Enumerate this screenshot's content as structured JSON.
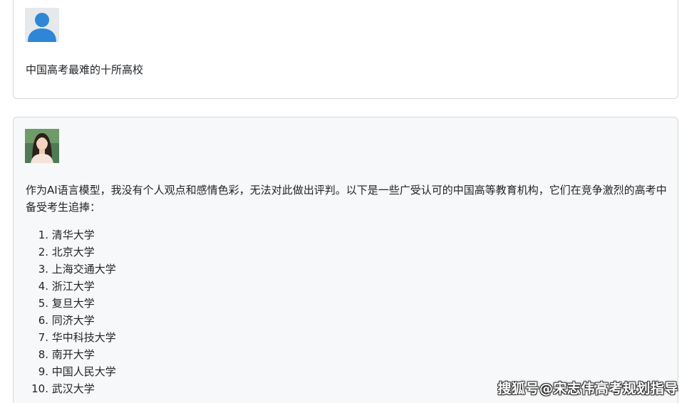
{
  "user_message": {
    "avatar_icon": "user-silhouette-icon",
    "avatar_color": "#2f86d6",
    "text": "中国高考最难的十所高校"
  },
  "ai_message": {
    "avatar_icon": "ai-portrait-avatar",
    "intro": "作为AI语言模型，我没有个人观点和感情色彩，无法对此做出评判。以下是一些广受认可的中国高等教育机构，它们在竞争激烈的高考中备受考生追捧：",
    "items": [
      {
        "num": "1.",
        "text": "清华大学"
      },
      {
        "num": "2.",
        "text": "北京大学"
      },
      {
        "num": "3.",
        "text": "上海交通大学"
      },
      {
        "num": "4.",
        "text": "浙江大学"
      },
      {
        "num": "5.",
        "text": "复旦大学"
      },
      {
        "num": "6.",
        "text": "同济大学"
      },
      {
        "num": "7.",
        "text": "华中科技大学"
      },
      {
        "num": "8.",
        "text": "南开大学"
      },
      {
        "num": "9.",
        "text": "中国人民大学"
      },
      {
        "num": "10.",
        "text": "武汉大学"
      }
    ]
  },
  "watermark": "搜狐号@宋志伟高考规划指导"
}
